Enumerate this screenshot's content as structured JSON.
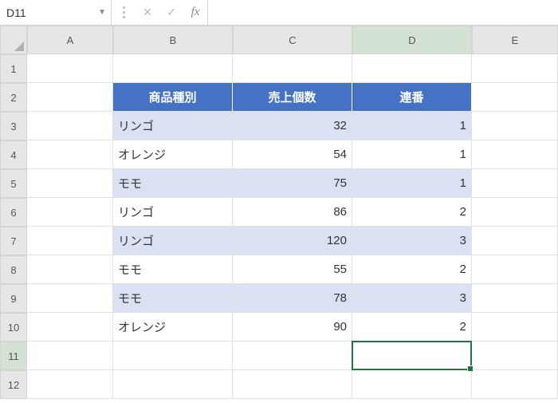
{
  "formula_bar": {
    "name_box": "D11",
    "formula": ""
  },
  "columns": [
    "A",
    "B",
    "C",
    "D",
    "E"
  ],
  "rows": [
    "1",
    "2",
    "3",
    "4",
    "5",
    "6",
    "7",
    "8",
    "9",
    "10",
    "11",
    "12"
  ],
  "active_cell": "D11",
  "table": {
    "headers": {
      "b": "商品種別",
      "c": "売上個数",
      "d": "連番"
    },
    "rows": [
      {
        "b": "リンゴ",
        "c": "32",
        "d": "1",
        "alt": true
      },
      {
        "b": "オレンジ",
        "c": "54",
        "d": "1",
        "alt": false
      },
      {
        "b": "モモ",
        "c": "75",
        "d": "1",
        "alt": true
      },
      {
        "b": "リンゴ",
        "c": "86",
        "d": "2",
        "alt": false
      },
      {
        "b": "リンゴ",
        "c": "120",
        "d": "3",
        "alt": true
      },
      {
        "b": "モモ",
        "c": "55",
        "d": "2",
        "alt": false
      },
      {
        "b": "モモ",
        "c": "78",
        "d": "3",
        "alt": true
      },
      {
        "b": "オレンジ",
        "c": "90",
        "d": "2",
        "alt": false
      }
    ]
  },
  "chart_data": {
    "type": "table",
    "title": "",
    "columns": [
      "商品種別",
      "売上個数",
      "連番"
    ],
    "rows": [
      [
        "リンゴ",
        32,
        1
      ],
      [
        "オレンジ",
        54,
        1
      ],
      [
        "モモ",
        75,
        1
      ],
      [
        "リンゴ",
        86,
        2
      ],
      [
        "リンゴ",
        120,
        3
      ],
      [
        "モモ",
        55,
        2
      ],
      [
        "モモ",
        78,
        3
      ],
      [
        "オレンジ",
        90,
        2
      ]
    ]
  }
}
